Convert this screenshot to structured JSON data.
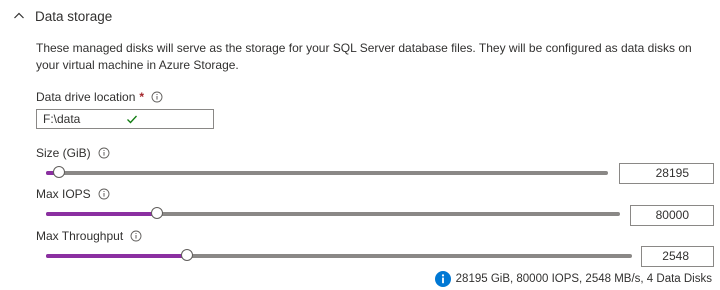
{
  "section": {
    "title": "Data storage",
    "description": "These managed disks will serve as the storage for your SQL Server database files. They will be configured as data disks on your virtual machine in Azure Storage."
  },
  "data_drive": {
    "label": "Data drive location",
    "required_marker": "*",
    "value": "F:\\data"
  },
  "size": {
    "label": "Size (GiB)",
    "value": "28195",
    "slider_fraction": 0.024
  },
  "max_iops": {
    "label": "Max IOPS",
    "value": "80000",
    "slider_fraction": 0.193
  },
  "max_throughput": {
    "label": "Max Throughput",
    "value": "2548",
    "slider_fraction": 0.24
  },
  "summary": {
    "text": "28195 GiB, 80000 IOPS, 2548 MB/s, 4 Data Disks"
  },
  "colors": {
    "slider_fill": "#8b2fa1",
    "info_blue": "#0078d4",
    "valid_green": "#107c10",
    "required_red": "#a4262c"
  },
  "icons": {
    "collapse": "chevron-up-icon",
    "info": "info-icon",
    "valid": "checkmark-icon",
    "summary": "info-filled-icon"
  }
}
